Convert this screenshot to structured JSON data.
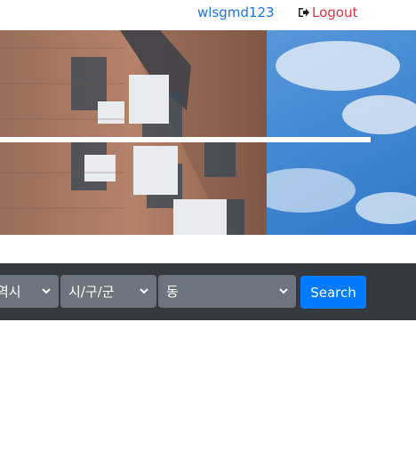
{
  "nav": {
    "username": "wlsgmd123",
    "logout_label": "Logout"
  },
  "search": {
    "sido_value": "역시",
    "gugun_value": "시/구/군",
    "dong_value": "동",
    "button_label": "Search"
  },
  "colors": {
    "user_link": "#1a73e8",
    "logout": "#dc3545",
    "search_bar_bg": "#343a40",
    "select_bg": "#6c757d",
    "search_button": "#007bff"
  },
  "icons": {
    "logout": "sign-out-icon",
    "select_chevron": "chevron-down-icon"
  }
}
